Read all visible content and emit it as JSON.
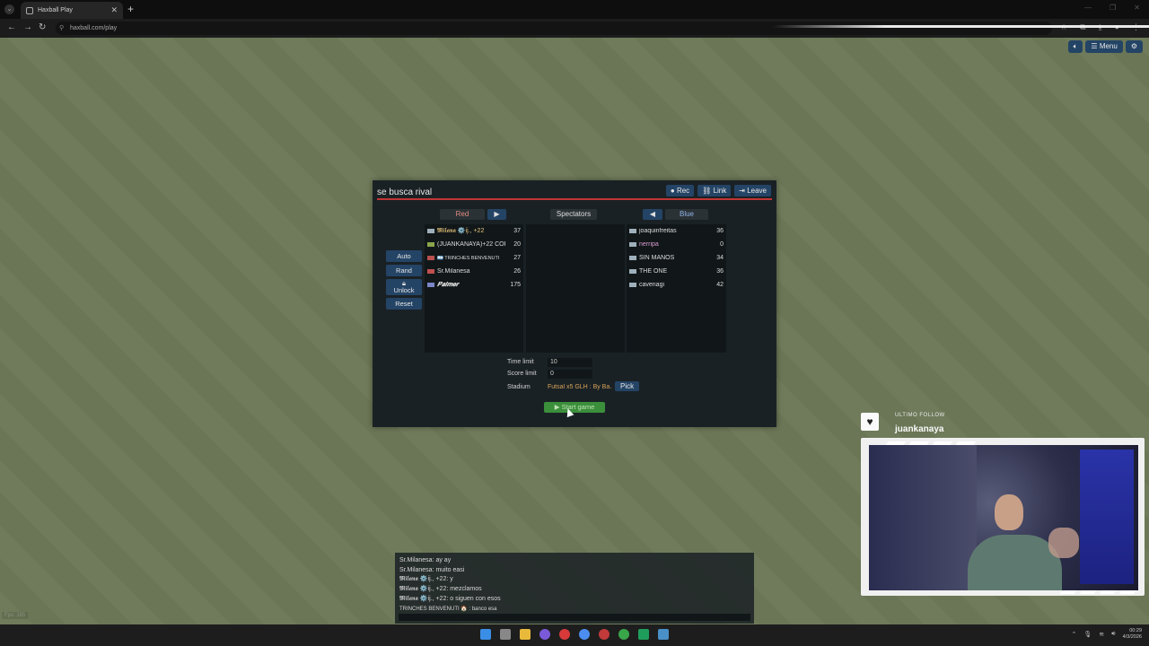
{
  "browser": {
    "tab_title": "Haxball Play",
    "url": "haxball.com/play"
  },
  "game_controls": {
    "volume_icon": "speaker-icon",
    "menu_label": "Menu",
    "settings_icon": "gear-icon"
  },
  "room": {
    "title": "se busca rival",
    "buttons": {
      "rec": "Rec",
      "link": "Link",
      "leave": "Leave"
    },
    "teams": {
      "red": "Red",
      "spectators": "Spectators",
      "blue": "Blue"
    },
    "red_players": [
      {
        "name": "𝕸𝖎𝖑𝖆𝖓𝖆 ⚙️ij., +22",
        "points": "37"
      },
      {
        "name": "(JUANKANAYA)+22 COF",
        "points": "20"
      },
      {
        "name": "🇦🇷 TRINCHES BENVENUTI",
        "points": "27"
      },
      {
        "name": "Sr.Milanesa",
        "points": "26"
      },
      {
        "name": "𝑷𝒂𝒍𝒎𝒆𝒓",
        "points": "175"
      }
    ],
    "blue_players": [
      {
        "name": "joaquinfreitas",
        "points": "36"
      },
      {
        "name": "nerripa",
        "points": "0"
      },
      {
        "name": "SIN MANOS",
        "points": "34"
      },
      {
        "name": "THE ONE",
        "points": "36"
      },
      {
        "name": "cavenagi",
        "points": "42"
      }
    ],
    "side_buttons": {
      "auto": "Auto",
      "rand": "Rand",
      "unlock": "Unlock",
      "reset": "Reset"
    },
    "settings": {
      "time_limit_label": "Time limit",
      "time_limit_value": "10",
      "score_limit_label": "Score limit",
      "score_limit_value": "0",
      "stadium_label": "Stadium",
      "stadium_value": "Futsal x5 GLH : By Ba...",
      "pick_label": "Pick"
    },
    "start_game": "Start game"
  },
  "chat": {
    "lines": [
      "Sr.Milanesa: ay ay",
      "Sr.Milanesa: muito easi",
      "𝕸𝖎𝖑𝖆𝖓𝖆 ⚙️ij., +22: y",
      "𝕸𝖎𝖑𝖆𝖓𝖆 ⚙️ij., +22: mezclamos",
      "𝕸𝖎𝖑𝖆𝖓𝖆 ⚙️ij., +22: o siguen con esos",
      "TRINCHES BENVENUTI 🏠 : banco esa"
    ]
  },
  "fps": "Fps: 185",
  "overlay": {
    "label": "ULTIMO FOLLOW",
    "name": "juankanaya",
    "icon": "heart-icon"
  },
  "taskbar": {
    "time": "00:29",
    "date": "4/3/2026"
  }
}
